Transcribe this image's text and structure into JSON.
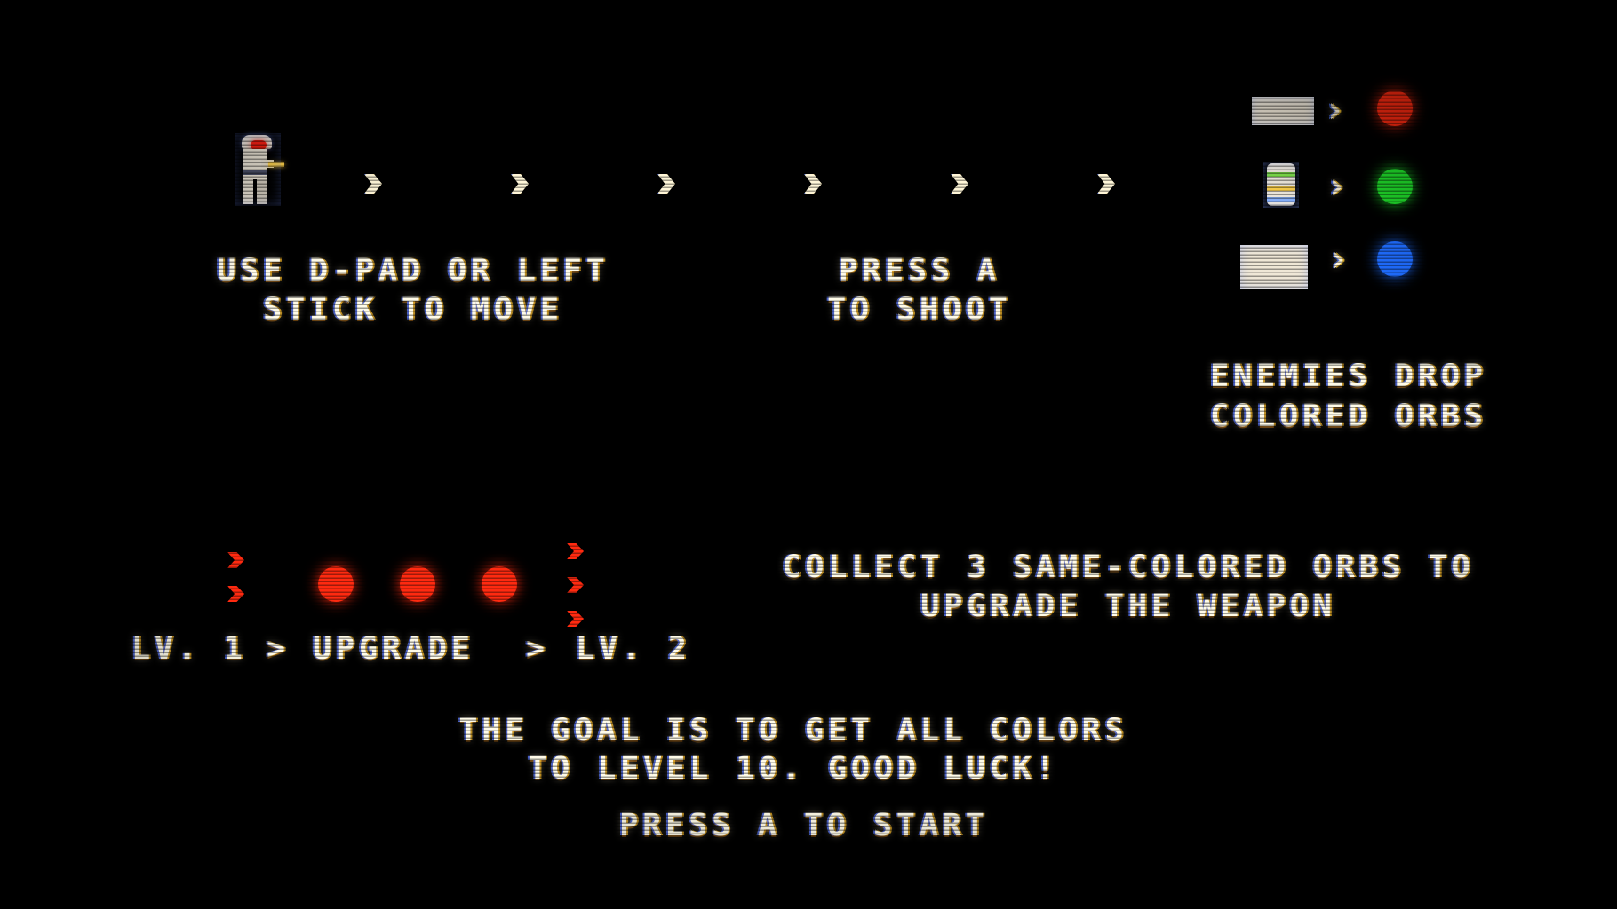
{
  "screen": {
    "title": "tutorial-screen",
    "background_color": "#000000"
  },
  "controls": {
    "move_line1": "USE D-PAD OR LEFT",
    "move_line2": "STICK TO MOVE",
    "shoot_line1": "PRESS A",
    "shoot_line2": "TO SHOOT"
  },
  "legend": {
    "caption_line1": "ENEMIES DROP",
    "caption_line2": "COLORED ORBS",
    "arrow": "›",
    "rows": [
      {
        "enemy": "bat-enemy",
        "orb_color": "#ff2a10",
        "orb_name": "red-orb"
      },
      {
        "enemy": "canister-enemy",
        "orb_color": "#1fdc2a",
        "orb_name": "green-orb"
      },
      {
        "enemy": "spider-enemy",
        "orb_color": "#1f6cff",
        "orb_name": "blue-orb"
      }
    ]
  },
  "upgrade": {
    "orb_color": "#ff2a10",
    "orb_count": 3,
    "bullets_before": 2,
    "bullets_after": 3,
    "level_from": "LV. 1",
    "arrow": ">",
    "action": "UPGRADE",
    "level_to": "LV. 2",
    "instruction_line1": "COLLECT 3 SAME-COLORED ORBS TO",
    "instruction_line2": "UPGRADE THE WEAPON"
  },
  "goal": {
    "line1": "THE GOAL IS TO GET ALL COLORS",
    "line2": "TO LEVEL 10. GOOD LUCK!"
  },
  "start": {
    "prompt": "PRESS A TO START"
  },
  "demo": {
    "bullet_count": 6
  }
}
